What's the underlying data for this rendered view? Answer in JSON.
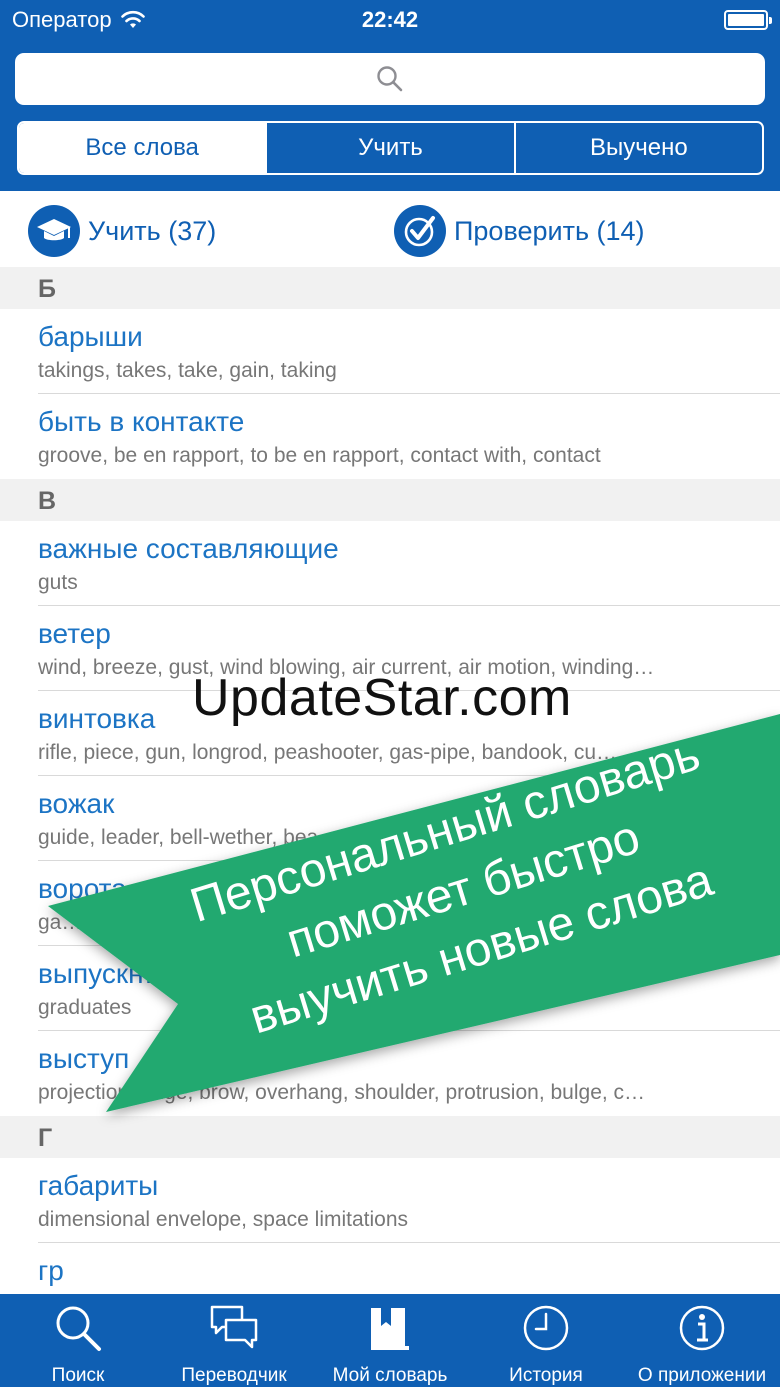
{
  "status": {
    "carrier": "Оператор",
    "time": "22:42"
  },
  "search": {
    "icon": "search-icon"
  },
  "segments": [
    "Все слова",
    "Учить",
    "Выучено"
  ],
  "actions": {
    "learn": {
      "label": "Учить (37)",
      "icon": "graduation-cap-icon"
    },
    "check": {
      "label": "Проверить (14)",
      "icon": "checkmark-icon"
    }
  },
  "list": {
    "sections": [
      {
        "letter": "Б",
        "rows": [
          {
            "word": "барыши",
            "trans": "takings, takes, take, gain, taking"
          },
          {
            "word": "быть в контакте",
            "trans": "groove, be en rapport, to be en rapport, contact with, contact"
          }
        ]
      },
      {
        "letter": "В",
        "rows": [
          {
            "word": "важные составляющие",
            "trans": "guts"
          },
          {
            "word": "ветер",
            "trans": "wind, breeze, gust, wind blowing, air current, air motion, winding…"
          },
          {
            "word": "винтовка",
            "trans": "rifle, piece, gun, longrod, peashooter, gas-pipe, bandook, cu…"
          },
          {
            "word": "вожак",
            "trans": "guide, leader, bell-wether, bea…"
          },
          {
            "word": "ворота",
            "trans": "ga…"
          },
          {
            "word": "выпускн…",
            "trans": "graduates"
          },
          {
            "word": "выступ",
            "trans": "projection, edge, brow, overhang, shoulder, protrusion, bulge, c…"
          }
        ]
      },
      {
        "letter": "Г",
        "rows": [
          {
            "word": "габариты",
            "trans": "dimensional envelope, space limitations"
          },
          {
            "word": "гр",
            "trans": ""
          }
        ]
      }
    ]
  },
  "watermark": "UpdateStar.com",
  "banner": {
    "line1": "Персональный словарь",
    "line2": "поможет быстро",
    "line3": "выучить новые слова",
    "color": "#22a970"
  },
  "tabbar": [
    {
      "label": "Поиск",
      "icon": "search-icon"
    },
    {
      "label": "Переводчик",
      "icon": "chat-bubbles-icon"
    },
    {
      "label": "Мой словарь",
      "icon": "book-icon"
    },
    {
      "label": "История",
      "icon": "clock-icon"
    },
    {
      "label": "О приложении",
      "icon": "info-icon"
    }
  ]
}
